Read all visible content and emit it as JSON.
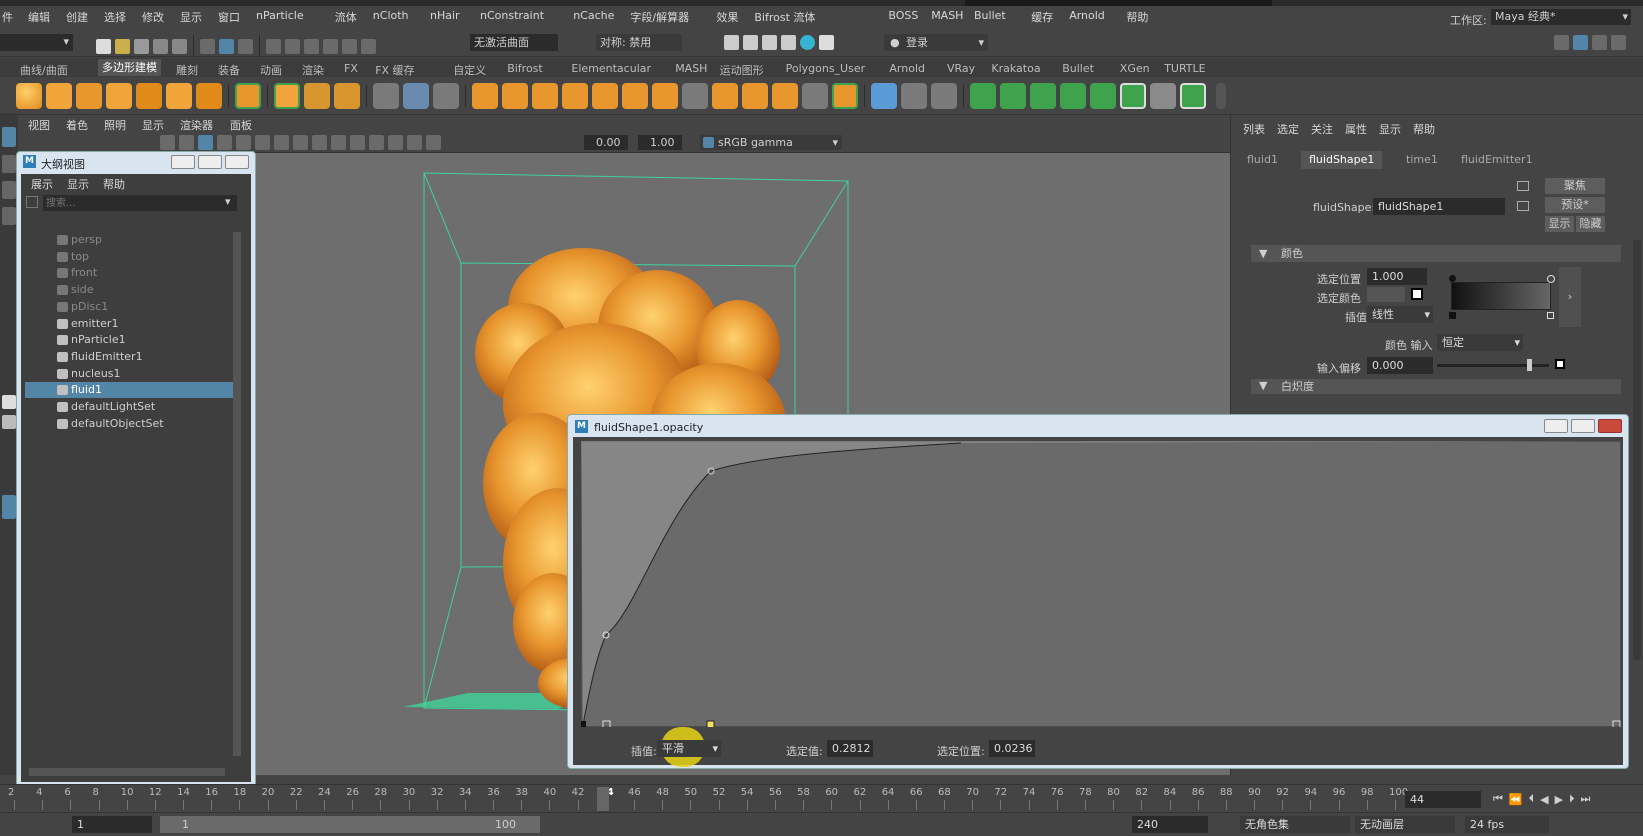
{
  "menu": [
    "件",
    "编辑",
    "创建",
    "选择",
    "修改",
    "显示",
    "窗口",
    "nParticle",
    "流体",
    "nCloth",
    "nHair",
    "nConstraint",
    "nCache",
    "字段/解算器",
    "效果",
    "Bifrost 流体",
    "BOSS",
    "MASH",
    "Bullet",
    "缓存",
    "Arnold",
    "帮助"
  ],
  "workspace": {
    "label": "工作区:",
    "value": "Maya 经典*"
  },
  "status": {
    "curve_field": "无激活曲面",
    "symmetry": "对称: 禁用",
    "login": "登录"
  },
  "shelf_tabs": [
    "曲线/曲面",
    "多边形建模",
    "雕刻",
    "装备",
    "动画",
    "渲染",
    "FX",
    "FX 缓存",
    "自定义",
    "Bifrost",
    "Elementacular",
    "MASH",
    "运动图形",
    "Polygons_User",
    "Arnold",
    "VRay",
    "Krakatoa",
    "Bullet",
    "XGen",
    "TURTLE"
  ],
  "viewport": {
    "menus": [
      "视图",
      "着色",
      "照明",
      "显示",
      "渲染器",
      "面板"
    ],
    "val1": "0.00",
    "val2": "1.00",
    "colorspace": "sRGB gamma"
  },
  "outliner": {
    "title": "大纲视图",
    "menus": [
      "展示",
      "显示",
      "帮助"
    ],
    "search_placeholder": "搜索...",
    "items": [
      {
        "label": "persp",
        "icon": "camera-icon",
        "dim": true
      },
      {
        "label": "top",
        "icon": "camera-icon",
        "dim": true
      },
      {
        "label": "front",
        "icon": "camera-icon",
        "dim": true
      },
      {
        "label": "side",
        "icon": "camera-icon",
        "dim": true
      },
      {
        "label": "pDisc1",
        "icon": "mesh-icon",
        "dim": true
      },
      {
        "label": "emitter1",
        "icon": "emitter-icon",
        "dim": false
      },
      {
        "label": "nParticle1",
        "icon": "particle-icon",
        "dim": false
      },
      {
        "label": "fluidEmitter1",
        "icon": "emitter-icon",
        "dim": false
      },
      {
        "label": "nucleus1",
        "icon": "nucleus-icon",
        "dim": false
      },
      {
        "label": "fluid1",
        "icon": "fluid-icon",
        "dim": false,
        "selected": true
      },
      {
        "label": "defaultLightSet",
        "icon": "set-icon",
        "dim": false
      },
      {
        "label": "defaultObjectSet",
        "icon": "set-icon",
        "dim": false
      }
    ]
  },
  "attr": {
    "menus": [
      "列表",
      "选定",
      "关注",
      "属性",
      "显示",
      "帮助"
    ],
    "tabs": [
      "fluid1",
      "fluidShape1",
      "time1",
      "fluidEmitter1"
    ],
    "active_tab": "fluidShape1",
    "shape_label": "fluidShape:",
    "shape_value": "fluidShape1",
    "btn_focus": "聚焦",
    "btn_preset": "预设*",
    "btn_show": "显示",
    "btn_hide": "隐藏",
    "color_section": "颜色",
    "sel_pos_label": "选定位置",
    "sel_pos_value": "1.000",
    "sel_color_label": "选定颜色",
    "interp_label": "插值",
    "interp_value": "线性",
    "color_input_label": "颜色 输入",
    "color_input_value": "恒定",
    "input_bias_label": "输入偏移",
    "input_bias_value": "0.000",
    "bias_fraction": 0.82,
    "next_section": "白炽度"
  },
  "opacity_window": {
    "title": "fluidShape1.opacity",
    "interp_label": "插值:",
    "interp_value": "平滑",
    "sel_value_label": "选定值:",
    "sel_value": "0.2812",
    "sel_pos_label": "选定位置:",
    "sel_pos": "0.0236"
  },
  "timeline": {
    "ticks": [
      "2",
      "4",
      "6",
      "8",
      "10",
      "12",
      "14",
      "16",
      "18",
      "20",
      "22",
      "24",
      "26",
      "28",
      "30",
      "32",
      "34",
      "36",
      "38",
      "40",
      "42",
      "44",
      "46",
      "48",
      "50",
      "52",
      "54",
      "56",
      "58",
      "60",
      "62",
      "64",
      "66",
      "68",
      "70",
      "72",
      "74",
      "76",
      "78",
      "80",
      "82",
      "84",
      "86",
      "88",
      "90",
      "92",
      "94",
      "96",
      "98",
      "100"
    ],
    "current": "44",
    "current_field": "44",
    "start": "1",
    "range_start": "1",
    "range_end": "100",
    "end": "240",
    "fps": "24 fps",
    "char_set": "无角色集",
    "anim_layer": "无动画层"
  },
  "colors": {
    "accent": "#5285a6",
    "wireframe": "#3fd39a",
    "fluid": "#e69a3a"
  }
}
